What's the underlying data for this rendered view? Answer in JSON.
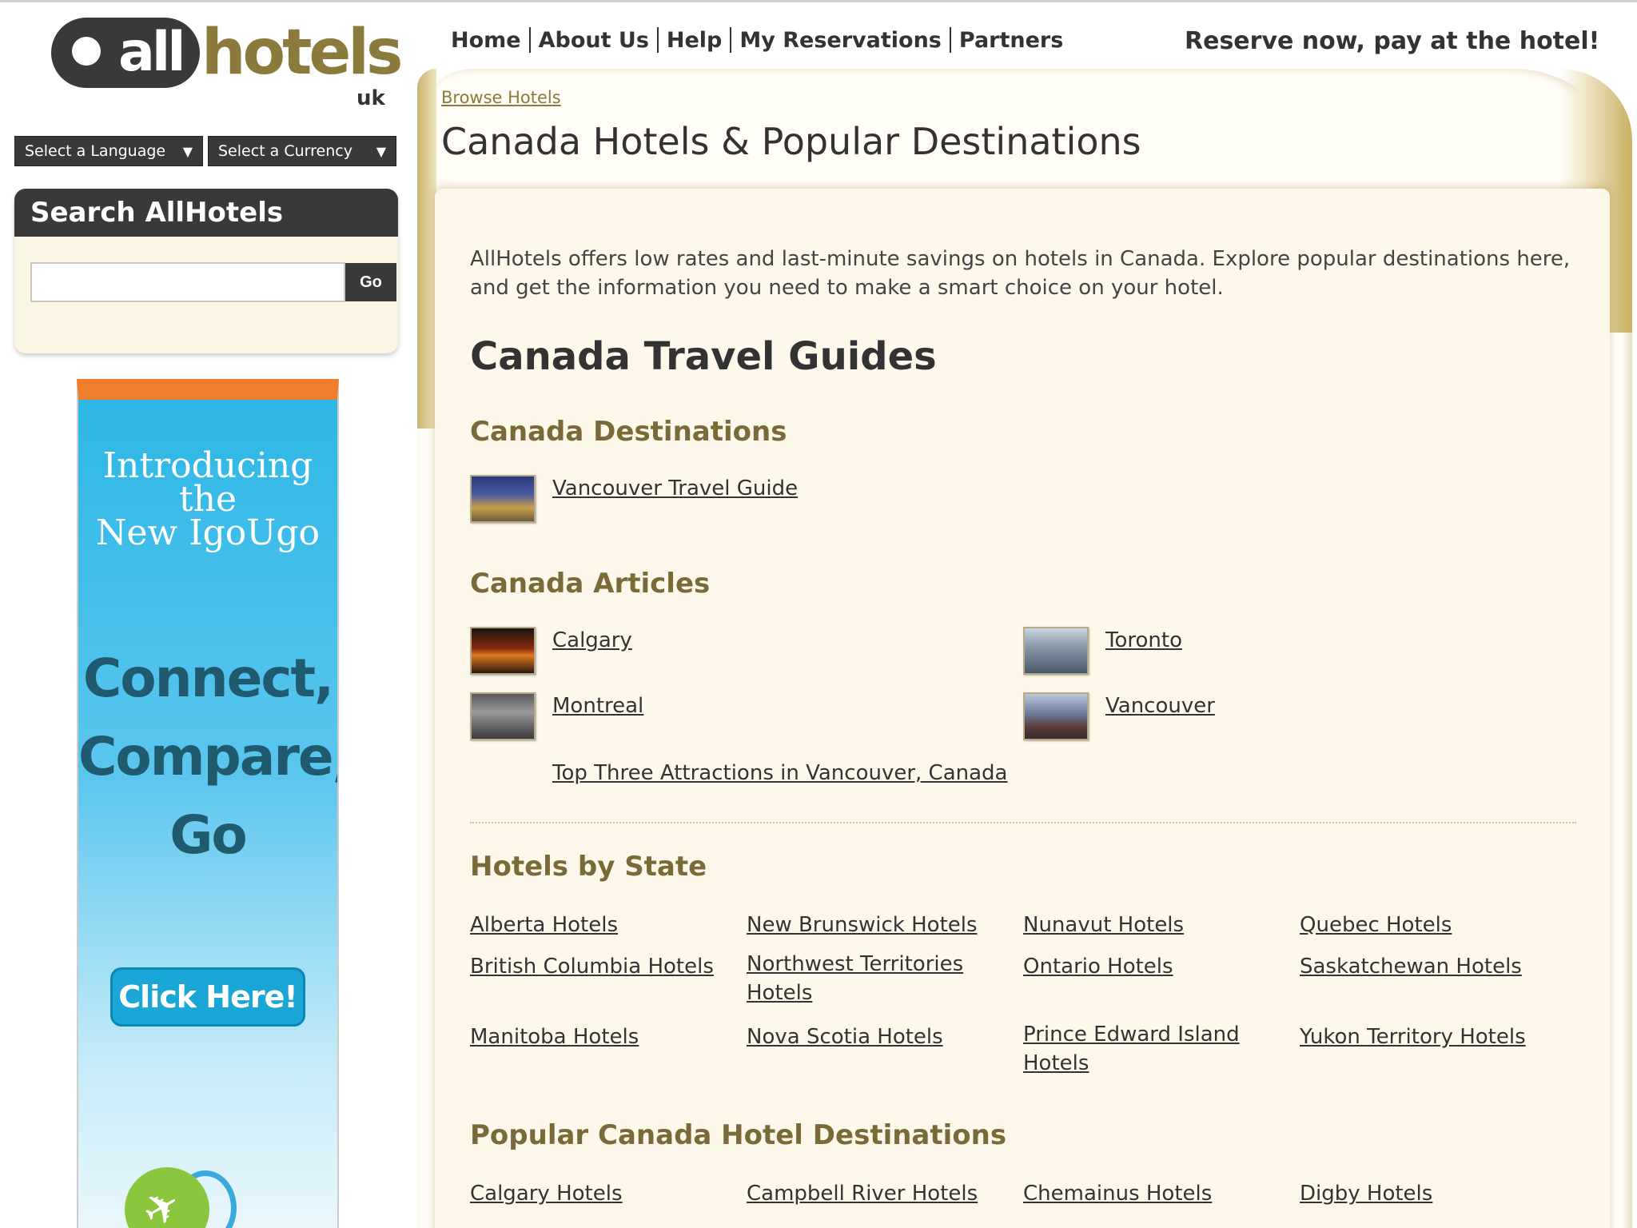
{
  "logo": {
    "all": "all",
    "hotels": "hotels",
    "uk": "uk"
  },
  "selectors": {
    "language": "Select a Language",
    "currency": "Select a Currency"
  },
  "search": {
    "title": "Search AllHotels",
    "go": "Go",
    "placeholder": ""
  },
  "ad": {
    "intro_line1": "Introducing",
    "intro_line2": "the",
    "intro_line3": "New IgoUgo",
    "tag_line1": "Connect,",
    "tag_line2": "Compare,",
    "tag_line3": "Go",
    "button": "Click Here!"
  },
  "nav": {
    "home": "Home",
    "about": "About Us",
    "help": "Help",
    "reservations": "My Reservations",
    "partners": "Partners"
  },
  "tagline": "Reserve now, pay at the hotel!",
  "breadcrumb": "Browse Hotels",
  "page_title": "Canada Hotels & Popular Destinations",
  "intro": "AllHotels offers low rates and last-minute savings on hotels in Canada. Explore popular destinations here, and get the information you need to make a smart choice on your hotel.",
  "guides_heading": "Canada Travel Guides",
  "destinations": {
    "heading": "Canada Destinations",
    "items": [
      "Vancouver Travel Guide"
    ]
  },
  "articles": {
    "heading": "Canada Articles",
    "items": [
      "Calgary",
      "Toronto",
      "Montreal",
      "Vancouver",
      "Top Three Attractions in Vancouver, Canada"
    ]
  },
  "states": {
    "heading": "Hotels by State",
    "items": [
      "Alberta Hotels",
      "New Brunswick Hotels",
      "Nunavut Hotels",
      "Quebec Hotels",
      "British Columbia Hotels",
      "Northwest Territories Hotels",
      "Ontario Hotels",
      "Saskatchewan Hotels",
      "Manitoba Hotels",
      "Nova Scotia Hotels",
      "Prince Edward Island Hotels",
      "Yukon Territory Hotels"
    ]
  },
  "popular": {
    "heading": "Popular Canada Hotel Destinations",
    "items": [
      "Calgary Hotels",
      "Campbell River Hotels",
      "Chemainus Hotels",
      "Digby Hotels"
    ]
  },
  "colors": {
    "dark": "#3b3937",
    "gold": "#8a7a3c",
    "cream": "#fdf8e9",
    "ad_orange": "#ef7d2b",
    "ad_blue": "#2db7e6"
  }
}
